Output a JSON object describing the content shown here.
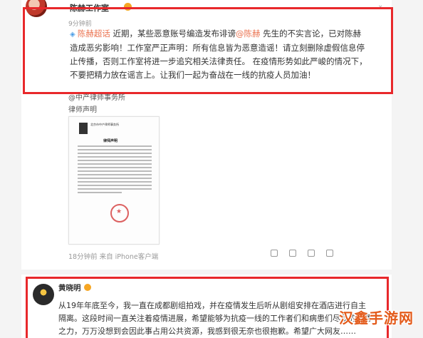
{
  "post1": {
    "author": "陈赫工作室",
    "time": "9分钟前",
    "text_parts": [
      {
        "type": "icon",
        "value": "◈"
      },
      {
        "type": "link",
        "value": "陈赫超话"
      },
      {
        "type": "text",
        "value": " 近期，某些恶意账号编造发布诽谤"
      },
      {
        "type": "link",
        "value": "@陈赫"
      },
      {
        "type": "text",
        "value": " 先生的不实言论，已对陈赫造成恶劣影响！工作室严正声明：所有信息皆为恶意造谣！请立刻删除虚假信息停止传播，否则工作室将进一步追究相关法律责任。 在疫情形势如此严峻的情况下，不要把精力放在谣言上。让我们一起为奋战在一线的抗疫人员加油！"
      }
    ],
    "repost_source": "@中产律师事务所",
    "repost_subtitle": "律师声明",
    "letter": {
      "header": "北京市中产律师事务所",
      "title": "律师声明"
    },
    "meta": "18分钟前 来自 iPhone客户端",
    "actions": [
      "",
      "",
      "",
      ""
    ]
  },
  "post2": {
    "author": "黄晓明",
    "time": "",
    "text": "从19年年底至今，我一直在成都剧组拍戏，并在疫情发生后听从剧组安排在酒店进行自主隔离。这段时间一直关注着疫情进展，希望能够为抗疫一线的工作者们和病患们尽我的绵薄之力，万万没想到会因此事占用公共资源，我感到很无奈也很抱歉。希望广大网友……"
  },
  "watermark": "汉鑫手游网",
  "colors": {
    "highlight_border": "#e8282b",
    "link": "#eb7350",
    "badge": "#f6a623"
  }
}
